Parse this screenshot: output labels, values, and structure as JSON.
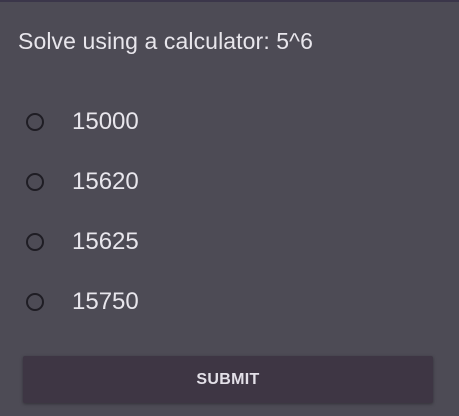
{
  "quiz": {
    "question": "Solve using a calculator: 5^6",
    "options": [
      {
        "label": "15000",
        "selected": false
      },
      {
        "label": "15620",
        "selected": false
      },
      {
        "label": "15625",
        "selected": false
      },
      {
        "label": "15750",
        "selected": false
      }
    ],
    "submit_label": "SUBMIT"
  },
  "colors": {
    "background": "#4d4b55",
    "button": "#3e3644",
    "radio_border": "#1f1d24"
  }
}
